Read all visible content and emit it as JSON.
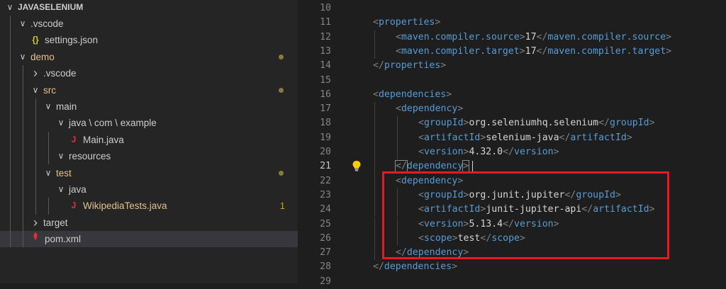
{
  "explorer": {
    "root_label": "JAVASELENIUM",
    "items": [
      {
        "label": "JAVASELENIUM",
        "kind": "root",
        "chevron": "down",
        "color": "#cccccc",
        "bold": true
      },
      {
        "label": ".vscode",
        "kind": "folder",
        "chevron": "down",
        "color": "#cccccc"
      },
      {
        "label": "settings.json",
        "kind": "file",
        "icon": "json-braces-icon",
        "icon_text": "{}",
        "icon_color": "#cbcb41",
        "color": "#cccccc"
      },
      {
        "label": "demo",
        "kind": "folder",
        "chevron": "down",
        "color": "#e2c08d",
        "modified": true
      },
      {
        "label": ".vscode",
        "kind": "folder",
        "chevron": "right",
        "color": "#cccccc"
      },
      {
        "label": "src",
        "kind": "folder",
        "chevron": "down",
        "color": "#e2c08d",
        "modified": true
      },
      {
        "label": "main",
        "kind": "folder",
        "chevron": "down",
        "color": "#cccccc"
      },
      {
        "label": "java \\ com \\ example",
        "kind": "folder",
        "chevron": "down",
        "color": "#cccccc"
      },
      {
        "label": "Main.java",
        "kind": "file",
        "icon": "java-icon",
        "icon_text": "J",
        "icon_color": "#e5303a",
        "color": "#cccccc"
      },
      {
        "label": "resources",
        "kind": "folder",
        "chevron": "down",
        "color": "#cccccc"
      },
      {
        "label": "test",
        "kind": "folder",
        "chevron": "down",
        "color": "#e2c08d",
        "modified": true
      },
      {
        "label": "java",
        "kind": "folder",
        "chevron": "down",
        "color": "#cccccc"
      },
      {
        "label": "WikipediaTests.java",
        "kind": "file",
        "icon": "java-icon",
        "icon_text": "J",
        "icon_color": "#e5303a",
        "color": "#e2c08d",
        "badge": "1"
      },
      {
        "label": "target",
        "kind": "folder",
        "chevron": "right",
        "color": "#cccccc"
      },
      {
        "label": "pom.xml",
        "kind": "file",
        "icon": "maven-feather-icon",
        "icon_text": "",
        "icon_color": "#e5303a",
        "color": "#cccccc",
        "selected": true
      }
    ]
  },
  "editor": {
    "active_line": "21",
    "lines": [
      {
        "n": "10",
        "tokens": []
      },
      {
        "n": "11",
        "tokens": [
          {
            "c": "p",
            "t": "<"
          },
          {
            "c": "t",
            "t": "properties"
          },
          {
            "c": "p",
            "t": ">"
          }
        ]
      },
      {
        "n": "12",
        "tokens": [
          {
            "c": "p",
            "t": "<"
          },
          {
            "c": "t",
            "t": "maven.compiler.source"
          },
          {
            "c": "p",
            "t": ">"
          },
          {
            "c": "tx",
            "t": "17"
          },
          {
            "c": "p",
            "t": "</"
          },
          {
            "c": "t",
            "t": "maven.compiler.source"
          },
          {
            "c": "p",
            "t": ">"
          }
        ]
      },
      {
        "n": "13",
        "tokens": [
          {
            "c": "p",
            "t": "<"
          },
          {
            "c": "t",
            "t": "maven.compiler.target"
          },
          {
            "c": "p",
            "t": ">"
          },
          {
            "c": "tx",
            "t": "17"
          },
          {
            "c": "p",
            "t": "</"
          },
          {
            "c": "t",
            "t": "maven.compiler.target"
          },
          {
            "c": "p",
            "t": ">"
          }
        ]
      },
      {
        "n": "14",
        "tokens": [
          {
            "c": "p",
            "t": "</"
          },
          {
            "c": "t",
            "t": "properties"
          },
          {
            "c": "p",
            "t": ">"
          }
        ]
      },
      {
        "n": "15",
        "tokens": []
      },
      {
        "n": "16",
        "tokens": [
          {
            "c": "p",
            "t": "<"
          },
          {
            "c": "t",
            "t": "dependencies"
          },
          {
            "c": "p",
            "t": ">"
          }
        ]
      },
      {
        "n": "17",
        "tokens": [
          {
            "c": "p",
            "t": "<"
          },
          {
            "c": "t",
            "t": "dependency"
          },
          {
            "c": "p",
            "t": ">"
          }
        ]
      },
      {
        "n": "18",
        "tokens": [
          {
            "c": "p",
            "t": "<"
          },
          {
            "c": "t",
            "t": "groupId"
          },
          {
            "c": "p",
            "t": ">"
          },
          {
            "c": "tx",
            "t": "org.seleniumhq.selenium"
          },
          {
            "c": "p",
            "t": "</"
          },
          {
            "c": "t",
            "t": "groupId"
          },
          {
            "c": "p",
            "t": ">"
          }
        ]
      },
      {
        "n": "19",
        "tokens": [
          {
            "c": "p",
            "t": "<"
          },
          {
            "c": "t",
            "t": "artifactId"
          },
          {
            "c": "p",
            "t": ">"
          },
          {
            "c": "tx",
            "t": "selenium-java"
          },
          {
            "c": "p",
            "t": "</"
          },
          {
            "c": "t",
            "t": "artifactId"
          },
          {
            "c": "p",
            "t": ">"
          }
        ]
      },
      {
        "n": "20",
        "tokens": [
          {
            "c": "p",
            "t": "<"
          },
          {
            "c": "t",
            "t": "version"
          },
          {
            "c": "p",
            "t": ">"
          },
          {
            "c": "tx",
            "t": "4.32.0"
          },
          {
            "c": "p",
            "t": "</"
          },
          {
            "c": "t",
            "t": "version"
          },
          {
            "c": "p",
            "t": ">"
          }
        ]
      },
      {
        "n": "21",
        "tokens": [
          {
            "c": "p",
            "t": "</",
            "box": true
          },
          {
            "c": "t",
            "t": "dependency"
          },
          {
            "c": "p",
            "t": ">",
            "box": true
          }
        ]
      },
      {
        "n": "22",
        "tokens": [
          {
            "c": "p",
            "t": "<"
          },
          {
            "c": "t",
            "t": "dependency"
          },
          {
            "c": "p",
            "t": ">"
          }
        ]
      },
      {
        "n": "23",
        "tokens": [
          {
            "c": "p",
            "t": "<"
          },
          {
            "c": "t",
            "t": "groupId"
          },
          {
            "c": "p",
            "t": ">"
          },
          {
            "c": "tx",
            "t": "org.junit.jupiter"
          },
          {
            "c": "p",
            "t": "</"
          },
          {
            "c": "t",
            "t": "groupId"
          },
          {
            "c": "p",
            "t": ">"
          }
        ]
      },
      {
        "n": "24",
        "tokens": [
          {
            "c": "p",
            "t": "<"
          },
          {
            "c": "t",
            "t": "artifactId"
          },
          {
            "c": "p",
            "t": ">"
          },
          {
            "c": "tx",
            "t": "junit-jupiter-api"
          },
          {
            "c": "p",
            "t": "</"
          },
          {
            "c": "t",
            "t": "artifactId"
          },
          {
            "c": "p",
            "t": ">"
          }
        ]
      },
      {
        "n": "25",
        "tokens": [
          {
            "c": "p",
            "t": "<"
          },
          {
            "c": "t",
            "t": "version"
          },
          {
            "c": "p",
            "t": ">"
          },
          {
            "c": "tx",
            "t": "5.13.4"
          },
          {
            "c": "p",
            "t": "</"
          },
          {
            "c": "t",
            "t": "version"
          },
          {
            "c": "p",
            "t": ">"
          }
        ]
      },
      {
        "n": "26",
        "tokens": [
          {
            "c": "p",
            "t": "<"
          },
          {
            "c": "t",
            "t": "scope"
          },
          {
            "c": "p",
            "t": ">"
          },
          {
            "c": "tx",
            "t": "test"
          },
          {
            "c": "p",
            "t": "</"
          },
          {
            "c": "t",
            "t": "scope"
          },
          {
            "c": "p",
            "t": ">"
          }
        ]
      },
      {
        "n": "27",
        "tokens": [
          {
            "c": "p",
            "t": "</"
          },
          {
            "c": "t",
            "t": "dependency"
          },
          {
            "c": "p",
            "t": ">"
          }
        ]
      },
      {
        "n": "28",
        "tokens": [
          {
            "c": "p",
            "t": "</"
          },
          {
            "c": "t",
            "t": "dependencies"
          },
          {
            "c": "p",
            "t": ">"
          }
        ]
      },
      {
        "n": "29",
        "tokens": []
      }
    ],
    "colors": {
      "tag": "#569cd6",
      "punct": "#808080",
      "text": "#d4d4d4",
      "highlight_box": "#e51b24"
    }
  }
}
